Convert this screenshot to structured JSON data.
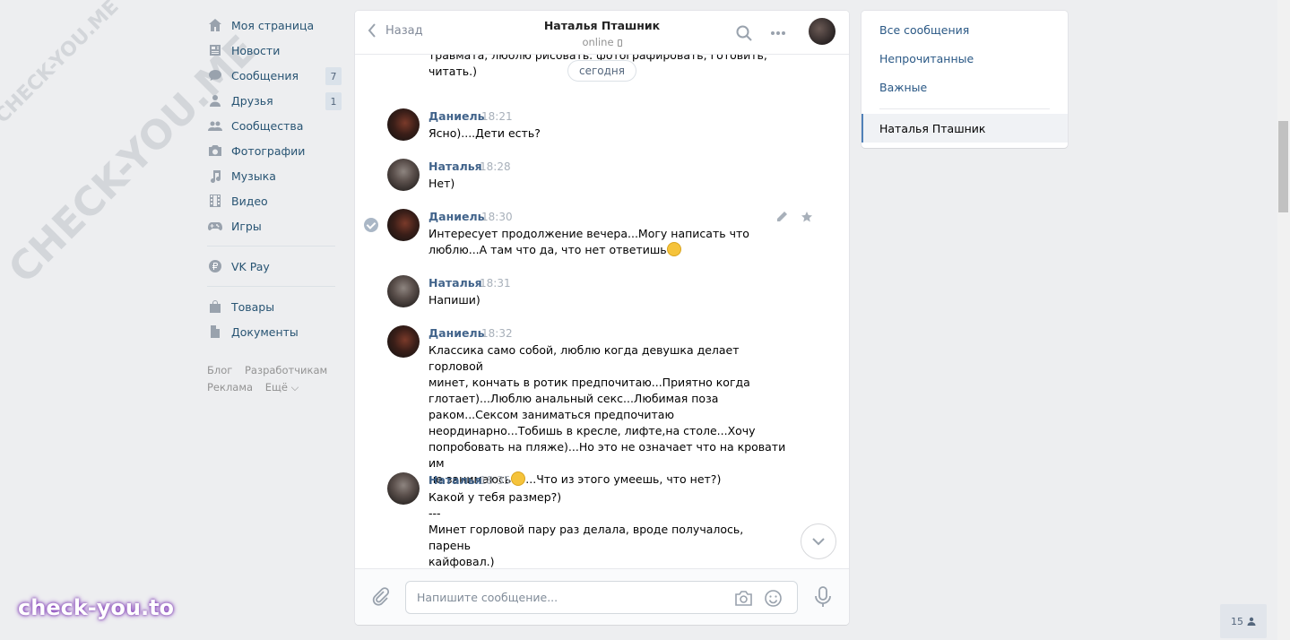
{
  "watermarks": {
    "small": "CHECK-YOU.ME",
    "large": "CHECK-YOU.ME",
    "brand": "check-you.to"
  },
  "nav": {
    "items": [
      {
        "label": "Моя страница",
        "icon": "home-icon"
      },
      {
        "label": "Новости",
        "icon": "news-icon"
      },
      {
        "label": "Сообщения",
        "icon": "messages-icon",
        "badge": "7"
      },
      {
        "label": "Друзья",
        "icon": "friends-icon",
        "badge": "1"
      },
      {
        "label": "Сообщества",
        "icon": "groups-icon"
      },
      {
        "label": "Фотографии",
        "icon": "camera-icon"
      },
      {
        "label": "Музыка",
        "icon": "music-icon"
      },
      {
        "label": "Видео",
        "icon": "video-icon"
      },
      {
        "label": "Игры",
        "icon": "gamepad-icon"
      }
    ],
    "pay": {
      "label": "VK Pay",
      "icon": "vkpay-icon"
    },
    "extra": [
      {
        "label": "Товары",
        "icon": "bag-icon"
      },
      {
        "label": "Документы",
        "icon": "document-icon"
      }
    ],
    "footer": {
      "blog": "Блог",
      "dev": "Разработчикам",
      "ads": "Реклама",
      "more": "Ещё ⌵"
    }
  },
  "chat": {
    "back_label": "Назад",
    "peer_name": "Наталья Пташник",
    "peer_status": "online",
    "date_separator": "сегодня",
    "top_fragment": "травмата, люблю рисовать. фотографировать, готовить,\nчитать.)",
    "messages": [
      {
        "author": "Даниель",
        "time": "18:21",
        "text": "Ясно)....Дети есть?"
      },
      {
        "author": "Наталья",
        "time": "18:28",
        "text": "Нет)"
      },
      {
        "author": "Даниель",
        "time": "18:30",
        "text": "Интересует продолжение вечера...Могу написать что\nлюблю...А там что да, что нет ответишь"
      },
      {
        "author": "Наталья",
        "time": "18:31",
        "text": "Напиши)"
      },
      {
        "author": "Даниель",
        "time": "18:32",
        "text": "Классика само собой, люблю когда девушка делает горловой\nминет, кончать в ротик предпочитаю...Приятно когда\nглотает)...Люблю анальный секс...Любимая поза\nраком...Сексом заниматься предпочитаю\nнеординарно...Тобишь в кресле, лифте,на столе...Хочу\nпопробовать на пляже)...Но это не означает что на кровати им\nне занимаюсь",
        "text_after": "...Что из этого умеешь, что нет?)"
      },
      {
        "author": "Наталья",
        "time": "18:35",
        "text": "Какой у тебя размер?)\n---\nМинет горловой пару раз делала, вроде получалось, парень\nкайфовал.)\nНа пляже и в лифте не было, было зимой в парке"
      }
    ],
    "composer_placeholder": "Напишите сообщение..."
  },
  "filters": {
    "all": "Все сообщения",
    "unread": "Непрочитанные",
    "important": "Важные",
    "active_dialog": "Наталья Пташник"
  },
  "online_count": "15",
  "colors": {
    "accent": "#5181b8",
    "link": "#2a5885",
    "author": "#42648b"
  }
}
